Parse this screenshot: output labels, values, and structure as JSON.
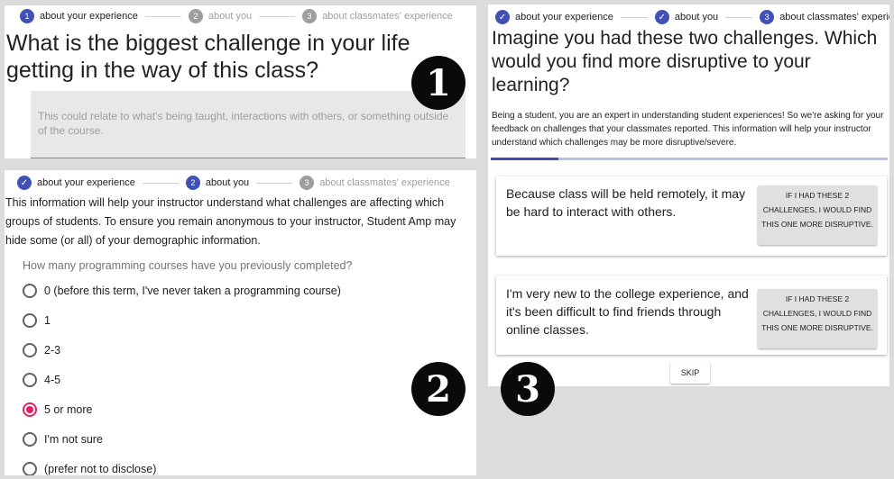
{
  "panel1": {
    "stepper": [
      {
        "number": "1",
        "label": "about your experience",
        "state": "active"
      },
      {
        "number": "2",
        "label": "about you",
        "state": "future"
      },
      {
        "number": "3",
        "label": "about classmates' experience",
        "state": "future"
      }
    ],
    "question": "What is the biggest challenge in your life getting in the way of this class?",
    "textarea_placeholder": "This could relate to what's being taught, interactions with others, or something outside of the course."
  },
  "panel2": {
    "stepper": [
      {
        "number": "✓",
        "label": "about your experience",
        "state": "done"
      },
      {
        "number": "2",
        "label": "about you",
        "state": "active"
      },
      {
        "number": "3",
        "label": "about classmates' experience",
        "state": "future"
      }
    ],
    "info": "This information will help your instructor understand what challenges are affecting which groups of students. To ensure you remain anonymous to your instructor, Student Amp may hide some (or all) of your demographic information.",
    "question": "How many programming courses have you previously completed?",
    "options": [
      {
        "label": "0 (before this term, I've never taken a programming course)",
        "checked": false
      },
      {
        "label": "1",
        "checked": false
      },
      {
        "label": "2-3",
        "checked": false
      },
      {
        "label": "4-5",
        "checked": false
      },
      {
        "label": "5 or more",
        "checked": true
      },
      {
        "label": "I'm not sure",
        "checked": false
      },
      {
        "label": "(prefer not to disclose)",
        "checked": false
      }
    ]
  },
  "panel3": {
    "stepper": [
      {
        "number": "✓",
        "label": "about your experience",
        "state": "done"
      },
      {
        "number": "✓",
        "label": "about you",
        "state": "done"
      },
      {
        "number": "3",
        "label": "about classmates' experience",
        "state": "active"
      }
    ],
    "question": "Imagine you had these two challenges. Which would you find more disruptive to your learning?",
    "info": "Being a student, you are an expert in understanding student experiences! So we're asking for your feedback on challenges that your classmates reported. This information will help your instructor understand which challenges may be more disruptive/severe.",
    "progress": 0.17,
    "cards": [
      {
        "text": "Because class will be held remotely, it may be hard to interact with others.",
        "button": "IF I HAD THESE 2 CHALLENGES, I WOULD FIND THIS ONE MORE DISRUPTIVE."
      },
      {
        "text": "I'm very new to the college experience, and it's been difficult to find friends through online classes.",
        "button": "IF I HAD THESE 2 CHALLENGES, I WOULD FIND THIS ONE MORE DISRUPTIVE."
      }
    ],
    "skip_label": "SKIP"
  },
  "badges": [
    "1",
    "2",
    "3"
  ],
  "colors": {
    "primary": "#3f51b5",
    "radio_selected": "#e91e63",
    "step_inactive": "#9e9e9e",
    "badge": "#0a0a0a"
  }
}
